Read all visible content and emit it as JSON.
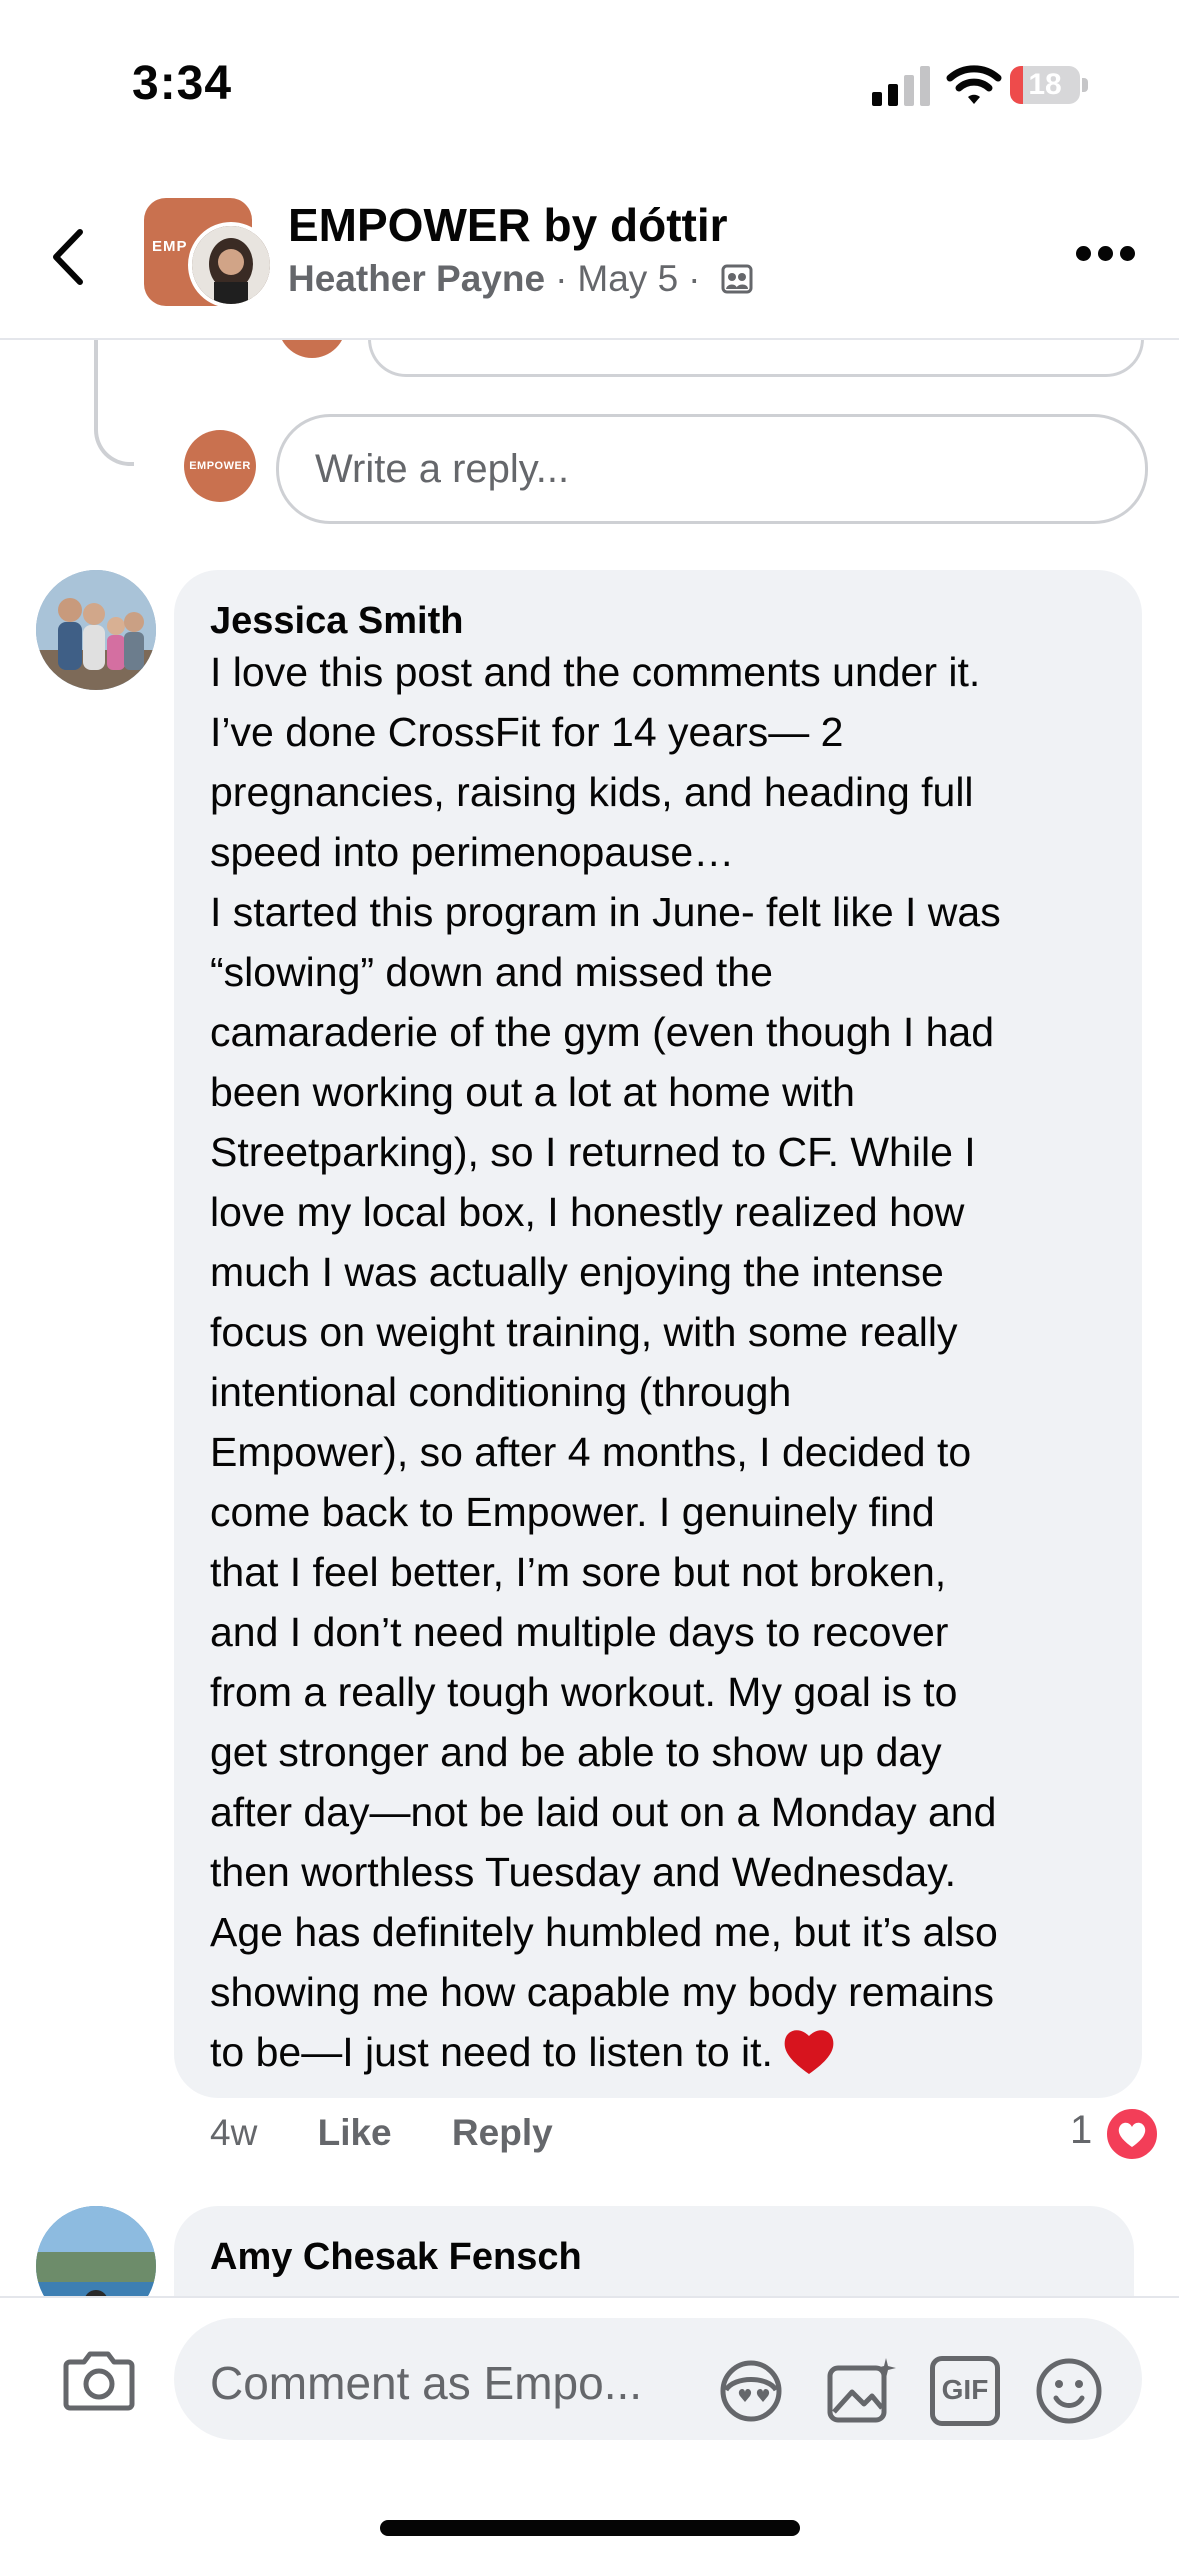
{
  "status_bar": {
    "time": "3:34",
    "battery": "18",
    "battery_level": 0.18,
    "accent_low": "#ee4b4b"
  },
  "header": {
    "title": "EMPOWER by dóttir",
    "author": "Heather Payne",
    "separator": "·",
    "date": "May 5",
    "group_avatar_text": "EMP",
    "icons": {
      "back": "chevron-left-icon",
      "audience": "group-audience-icon",
      "more": "more-dots-icon"
    }
  },
  "reply_box": {
    "avatar_text": "EMPOWER",
    "placeholder": "Write a reply..."
  },
  "comments": [
    {
      "author": "Jessica Smith",
      "lines": [
        "I love this post and the comments under it.",
        "I’ve done CrossFit for 14 years— 2",
        "pregnancies, raising kids, and heading full",
        "speed into perimenopause…",
        "I started this program in June- felt like I was",
        "“slowing” down and missed the",
        "camaraderie of the gym (even though I had",
        "been working out a lot at home with",
        "Streetparking), so I returned to CF. While I",
        "love my local box, I honestly realized how",
        "much I was actually enjoying the intense",
        "focus on weight training, with some really",
        "intentional conditioning (through",
        "Empower), so after 4 months, I decided to",
        "come back to Empower. I genuinely find",
        "that I feel better, I’m sore but not broken,",
        "and I don’t need multiple days to recover",
        "from a really tough workout. My goal is to",
        "get stronger and be able to show up day",
        "after day—not be laid out on a Monday and",
        "then worthless Tuesday and Wednesday.",
        "Age has definitely humbled me, but it’s also",
        "showing me how capable my body remains",
        "to be—I just need to listen to it."
      ],
      "time": "4w",
      "like_label": "Like",
      "reply_label": "Reply",
      "reaction_count": "1",
      "reaction_icon": "love-reaction-icon",
      "reaction_color": "#f33e58"
    },
    {
      "author": "Amy Chesak Fensch"
    }
  ],
  "composer": {
    "placeholder": "Comment as Empo...",
    "icons": [
      "camera-icon",
      "avatar-sticker-icon",
      "photo-add-icon",
      "gif-icon",
      "emoji-icon"
    ],
    "gif_label": "GIF"
  },
  "colors": {
    "bubble": "#f0f2f5",
    "secondary_text": "#65676b",
    "brand": "#c9714f"
  }
}
